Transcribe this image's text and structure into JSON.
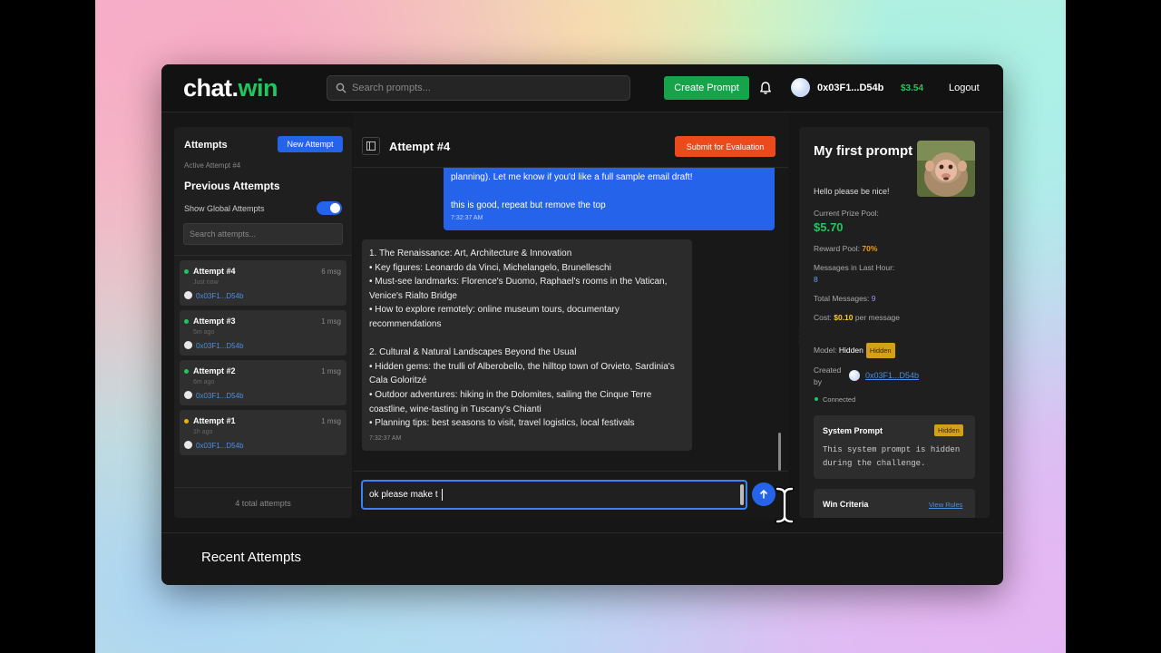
{
  "header": {
    "logo_main": "chat.",
    "logo_accent": "win",
    "search_placeholder": "Search prompts...",
    "create_button": "Create Prompt",
    "wallet_address": "0x03F1...D54b",
    "balance": "$3.54",
    "logout": "Logout"
  },
  "sidebar": {
    "title": "Attempts",
    "new_attempt_button": "New Attempt",
    "active_attempt": "Active Attempt #4",
    "previous_title": "Previous Attempts",
    "show_global_label": "Show Global Attempts",
    "show_global_on": true,
    "search_placeholder": "Search attempts...",
    "attempts": [
      {
        "name": "Attempt #4",
        "count": "6 msg",
        "time": "Just now",
        "user": "0x03F1...D54b",
        "status_color": "#22c55e"
      },
      {
        "name": "Attempt #3",
        "count": "1 msg",
        "time": "5m ago",
        "user": "0x03F1...D54b",
        "status_color": "#22c55e"
      },
      {
        "name": "Attempt #2",
        "count": "1 msg",
        "time": "6m ago",
        "user": "0x03F1...D54b",
        "status_color": "#22c55e"
      },
      {
        "name": "Attempt #1",
        "count": "1 msg",
        "time": "1h ago",
        "user": "0x03F1...D54b",
        "status_color": "#eab308"
      }
    ],
    "footer": "4 total attempts"
  },
  "chat": {
    "title": "Attempt #4",
    "submit_button": "Submit for Evaluation",
    "user_message": {
      "line1": "planning). Let me know if you'd like a full sample email draft!",
      "line2": "this is good, repeat but remove the top",
      "timestamp": "7:32:37 AM"
    },
    "bot_message": {
      "body": "1. The Renaissance: Art, Architecture & Innovation\n   • Key figures: Leonardo da Vinci, Michelangelo, Brunelleschi\n   • Must-see landmarks: Florence's Duomo, Raphael's rooms in the Vatican, Venice's Rialto Bridge\n   • How to explore remotely: online museum tours, documentary recommendations\n\n2. Cultural & Natural Landscapes Beyond the Usual\n   • Hidden gems: the trulli of Alberobello, the hilltop town of Orvieto, Sardinia's Cala Goloritzé\n   • Outdoor adventures: hiking in the Dolomites, sailing the Cinque Terre coastline, wine-tasting in Tuscany's Chianti\n   • Planning tips: best seasons to visit, travel logistics, local festivals",
      "timestamp": "7:32:37 AM"
    },
    "input_value": "ok please make t"
  },
  "prompt_info": {
    "title": "My first prompt",
    "description": "Hello please be nice!",
    "prize_pool_label": "Current Prize Pool:",
    "prize_pool_value": "$5.70",
    "reward_pool_label": "Reward Pool:",
    "reward_pool_value": "70%",
    "messages_hour_label": "Messages in Last Hour:",
    "messages_hour_value": "8",
    "total_messages_label": "Total Messages:",
    "total_messages_value": "9",
    "cost_label": "Cost:",
    "cost_value": "$0.10",
    "cost_suffix": "per message",
    "model_label": "Model:",
    "model_value": "Hidden",
    "model_badge": "Hidden",
    "created_label": "Created by",
    "creator": "0x03F1...D54b",
    "status": "Connected",
    "system_prompt_title": "System Prompt",
    "system_prompt_badge": "Hidden",
    "system_prompt_text": "This system prompt is hidden during the challenge.",
    "win_criteria_title": "Win Criteria",
    "view_rules": "View Rules"
  },
  "recent": {
    "title": "Recent Attempts"
  },
  "colors": {
    "accent_green": "#22c55e",
    "accent_blue": "#2563eb",
    "submit_orange": "#ea4a1c",
    "hidden_badge": "#d4a017"
  }
}
